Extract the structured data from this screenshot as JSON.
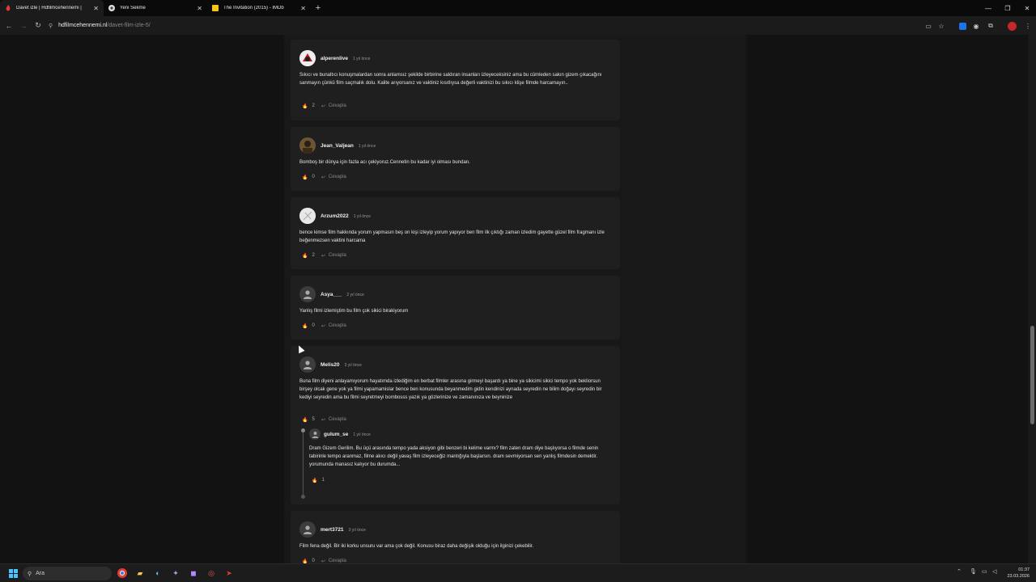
{
  "tabs": [
    {
      "title": "Davet izle | Hdfilmcehennemi |",
      "icon": "fire-icon",
      "active": true
    },
    {
      "title": "Yeni Sekme",
      "icon": "chrome-icon",
      "active": false
    },
    {
      "title": "The Invitation (2015) - IMDb",
      "icon": "imdb-icon",
      "active": false
    }
  ],
  "address": {
    "host": "hdfilmcehennemi.nl",
    "path": "/davet-film-izle-5/"
  },
  "reply_label": "Cevapla",
  "comments": [
    {
      "user": "alperenlive",
      "time": "1 yıl önce",
      "text": "Sıkıcı ve bunaltıcı konuşmalardan sonra anlamsız şekilde birbirine saldıran insanları izleyeceksiniz ama bu cümleden sakın gizem çıkacağını sanmayın çünkü film saçmalık dolu. Kalite arıyorsanız ve vaktiniz kısıtlıysa değerli vaktinizi bu sıkıcı klişe filmde harcamayın..",
      "likes": "2",
      "avatar": "red"
    },
    {
      "user": "Jean_Valjean",
      "time": "1 yıl önce",
      "text": "Bomboş bir dünya için fazla acı çekiyoruz.Cennetin bu kadar iyi olması bundan.",
      "likes": "0",
      "avatar": "photo"
    },
    {
      "user": "Arzum2022",
      "time": "1 yıl önce",
      "text": "bence kimse film hakkında yorum yapmasın beş on kişi izleyip yorum yapıyor ben film ilk çıktığı zaman izledim gayette güzel film fragmanı izle beğenmezsen vaktini harcama",
      "likes": "2",
      "avatar": "light"
    },
    {
      "user": "Asya___",
      "time": "2 yıl önce",
      "text": "Yanlış filmi izlemiştim bu film çok sikici birakiyorum",
      "likes": "0",
      "avatar": "default"
    },
    {
      "user": "Melis20",
      "time": "3 yıl önce",
      "text": "Buna film diyeni anlayamıyorum hayatımda izlediğim en berbat filmler arasına girmeyi başardı ya bine ya sikicimi sikici tempo yok bekliorsun birşey olcak gene yok ya filmi yapamamislar bence ben konusunda beyanmedim gidin kendinizi aynada seyredin ne bilim doğayı seyredin bir kediyi seyredin ama bu filmi seyretmeyi bombosss yazık ya gözlerinize ve zamanınıza ve beyninize",
      "likes": "5",
      "avatar": "default",
      "reply": {
        "user": "gulum_se",
        "time": "1 yıl önce",
        "text": "Dram Gizem Gerilim. Bu üçü arasında tempo yada aksiyon gibi benzeri bi kelime varmı? film zaten dram diye başlıyorsa o filmde senin tabirinle tempo aranmaz, filme akıcı değil yavaş film izleyeceğiz mantığıyla başlarsın. dram sevmiyorsan sen yanlış filmdesin demektir. yorumunda manasız kalıyor bu durumda...",
        "likes": "1"
      }
    },
    {
      "user": "mert3721",
      "time": "3 yıl önce",
      "text": "Film fena değil. Bir iki korku unsuru var ama çok değil. Konusu biraz daha değişik olduğu için ilginizi çekebilir.",
      "likes": "0",
      "avatar": "default"
    }
  ],
  "taskbar": {
    "search_label": "Ara",
    "time": "01:37",
    "date": "23.03.2026"
  }
}
